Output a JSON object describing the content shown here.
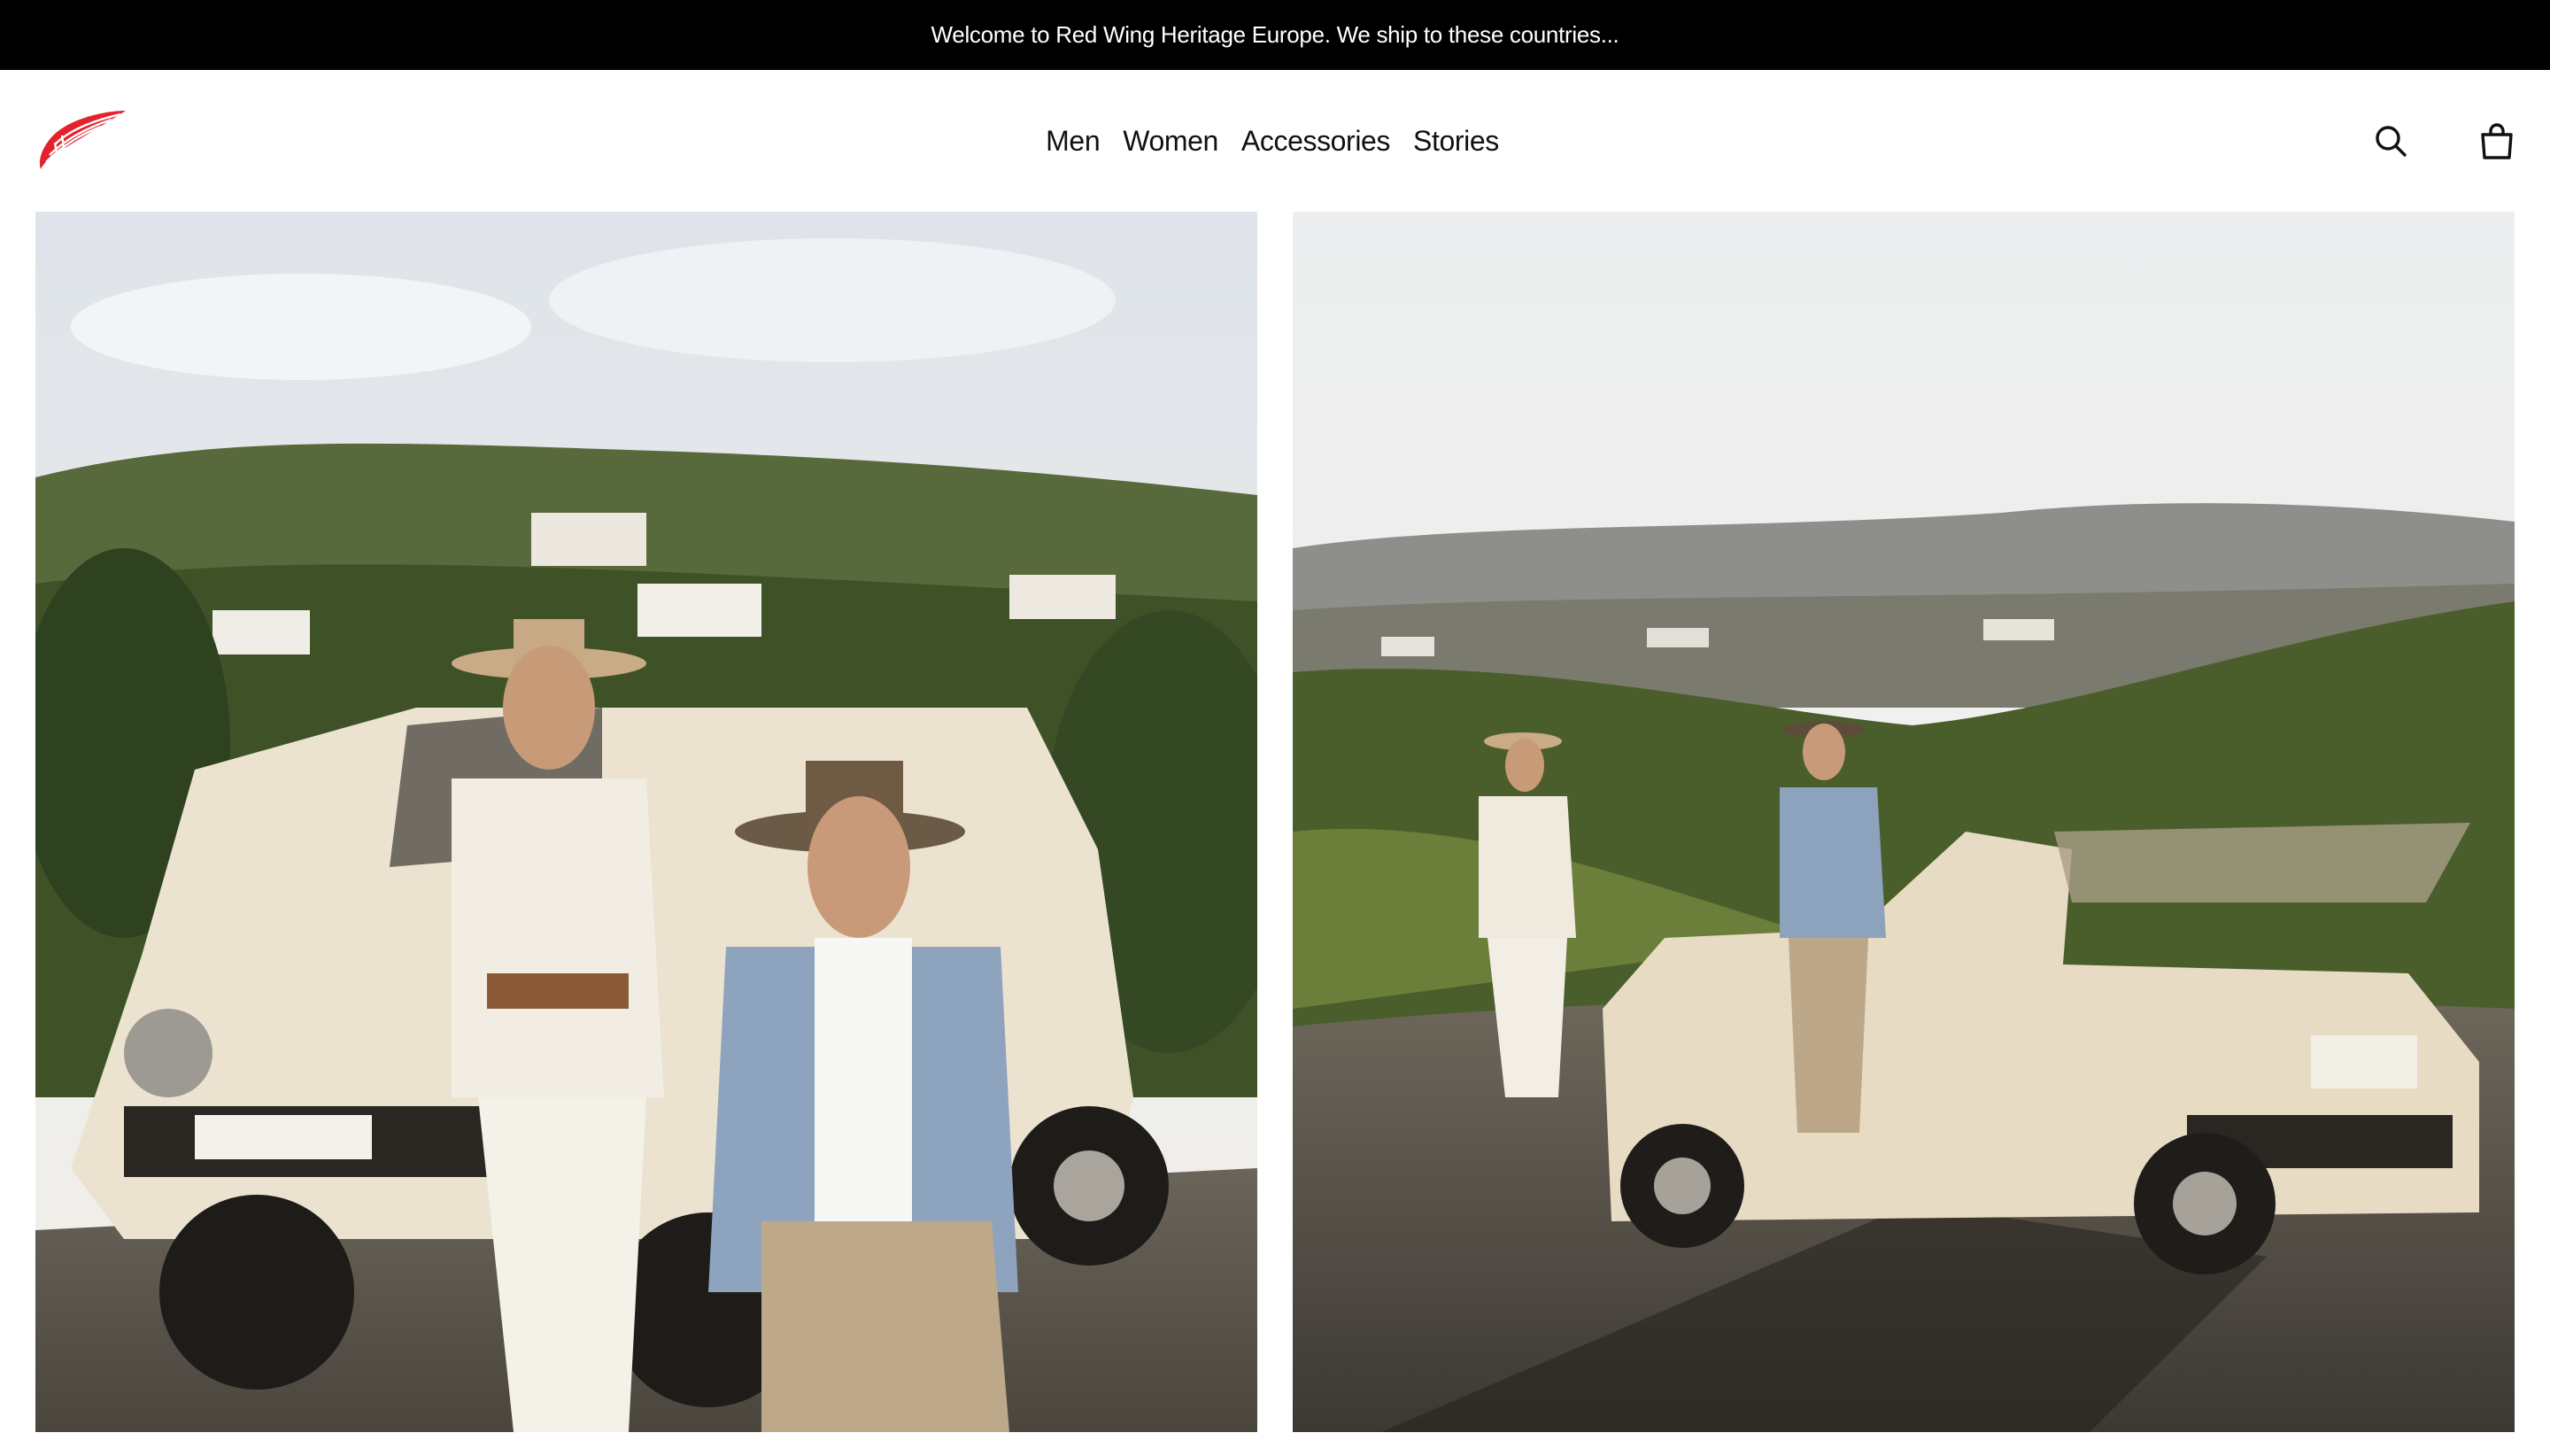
{
  "announcement": {
    "text": "Welcome to Red Wing Heritage Europe. We ship to these countries..."
  },
  "header": {
    "logo_name": "red-wing-logo",
    "nav": [
      {
        "label": "Men"
      },
      {
        "label": "Women"
      },
      {
        "label": "Accessories"
      },
      {
        "label": "Stories"
      }
    ],
    "icons": {
      "search": "search-icon",
      "bag": "shopping-bag-icon"
    }
  },
  "colors": {
    "brand_red": "#e3222c",
    "announcement_bg": "#000000",
    "text": "#111111"
  },
  "gallery": {
    "images": [
      {
        "name": "couple-standing-by-cream-jeep"
      },
      {
        "name": "couple-with-jeep-overlooking-valley"
      }
    ]
  }
}
